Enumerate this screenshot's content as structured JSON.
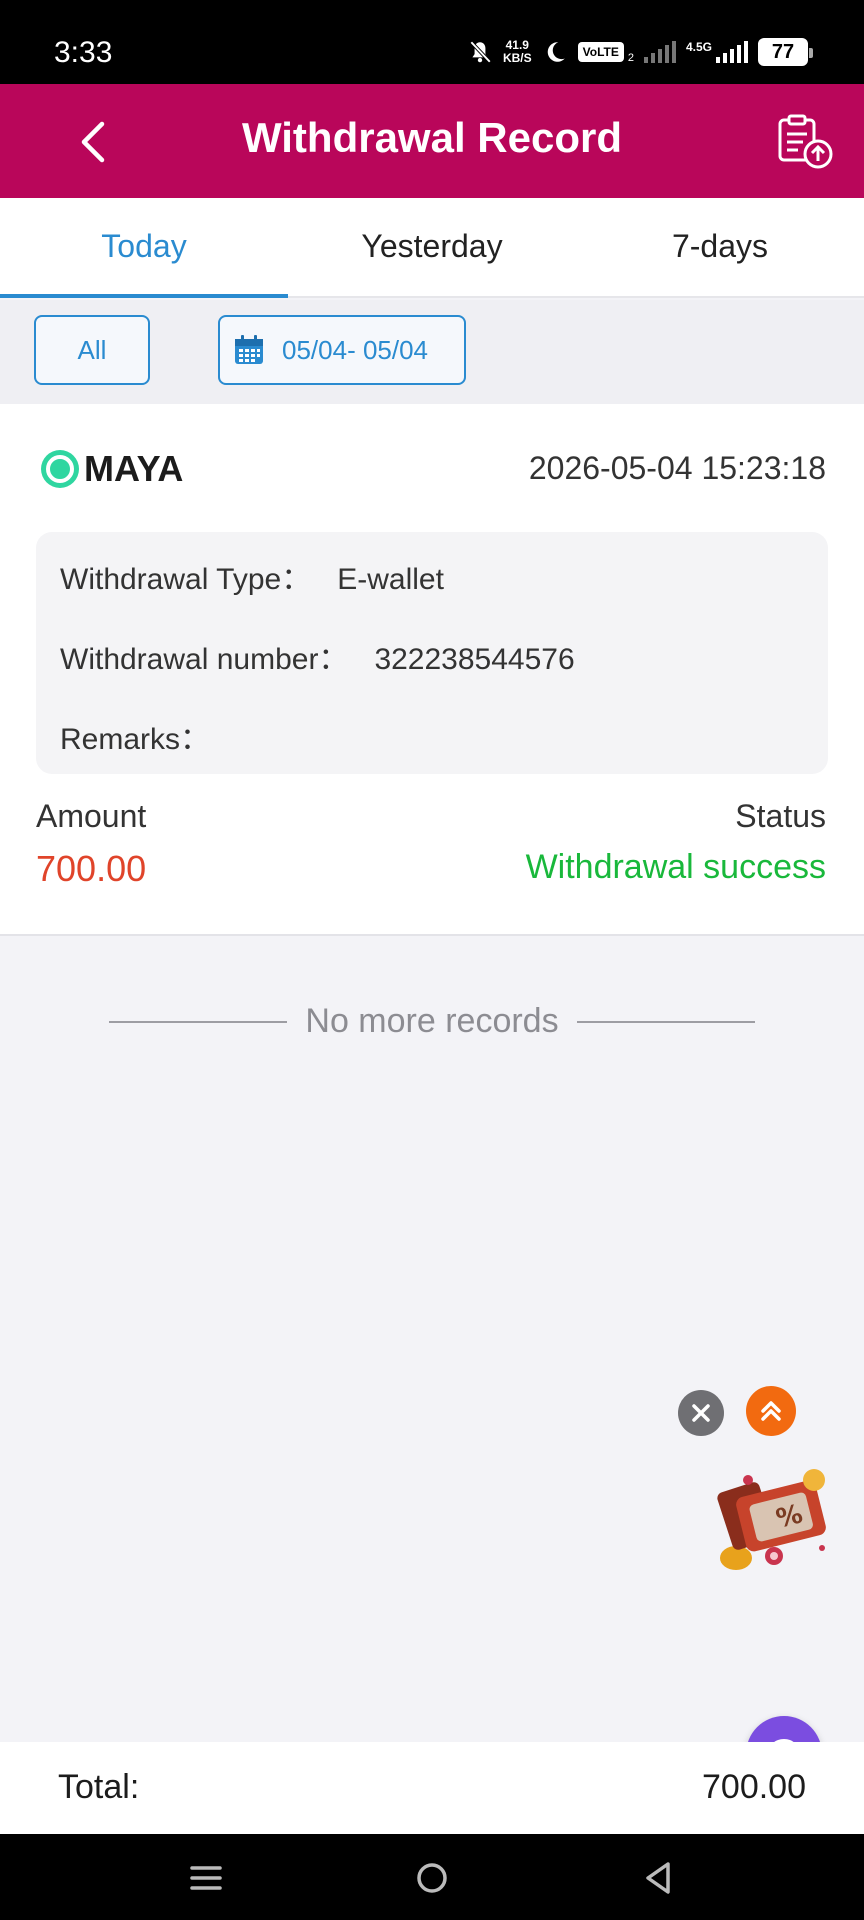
{
  "status_bar": {
    "time": "3:33",
    "speed_value": "41.9",
    "speed_unit": "KB/S",
    "volte": "VoLTE",
    "volte_sim": "2",
    "network": "4.5G",
    "battery": "77"
  },
  "header": {
    "title": "Withdrawal Record"
  },
  "tabs": [
    {
      "label": "Today",
      "active": true
    },
    {
      "label": "Yesterday",
      "active": false
    },
    {
      "label": "7-days",
      "active": false
    }
  ],
  "filters": {
    "type_label": "All",
    "date_range": "05/04- 05/04"
  },
  "record": {
    "brand": "MAYA",
    "timestamp": "2026-05-04 15:23:18",
    "withdrawal_type_label": "Withdrawal Type：",
    "withdrawal_type_value": "E-wallet",
    "withdrawal_number_label": "Withdrawal number：",
    "withdrawal_number_value": "322238544576",
    "remarks_label": "Remarks：",
    "remarks_value": "",
    "amount_label": "Amount",
    "amount_value": "700.00",
    "status_label": "Status",
    "status_value": "Withdrawal success"
  },
  "list_end_text": "No more records",
  "total": {
    "label": "Total:",
    "value": "700.00"
  },
  "colors": {
    "header_bg": "#b9065a",
    "accent": "#2a8bd0",
    "amount": "#e0442a",
    "success": "#19b83b"
  }
}
